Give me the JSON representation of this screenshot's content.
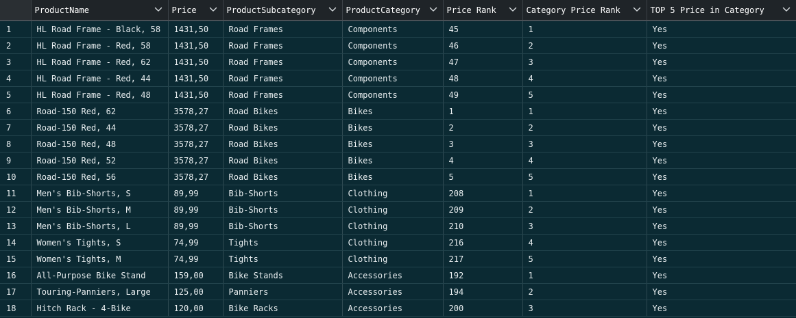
{
  "grid": {
    "columns": [
      {
        "key": "row",
        "label": ""
      },
      {
        "key": "ProductName",
        "label": "ProductName"
      },
      {
        "key": "Price",
        "label": "Price"
      },
      {
        "key": "ProductSubcategory",
        "label": "ProductSubcategory"
      },
      {
        "key": "ProductCategory",
        "label": "ProductCategory"
      },
      {
        "key": "PriceRank",
        "label": "Price Rank"
      },
      {
        "key": "CategoryPriceRank",
        "label": "Category Price Rank"
      },
      {
        "key": "Top5",
        "label": "TOP 5 Price in Category"
      }
    ],
    "rows": [
      [
        "1",
        "HL Road Frame - Black, 58",
        "1431,50",
        "Road Frames",
        "Components",
        "45",
        "1",
        "Yes"
      ],
      [
        "2",
        "HL Road Frame - Red, 58",
        "1431,50",
        "Road Frames",
        "Components",
        "46",
        "2",
        "Yes"
      ],
      [
        "3",
        "HL Road Frame - Red, 62",
        "1431,50",
        "Road Frames",
        "Components",
        "47",
        "3",
        "Yes"
      ],
      [
        "4",
        "HL Road Frame - Red, 44",
        "1431,50",
        "Road Frames",
        "Components",
        "48",
        "4",
        "Yes"
      ],
      [
        "5",
        "HL Road Frame - Red, 48",
        "1431,50",
        "Road Frames",
        "Components",
        "49",
        "5",
        "Yes"
      ],
      [
        "6",
        "Road-150 Red, 62",
        "3578,27",
        "Road Bikes",
        "Bikes",
        "1",
        "1",
        "Yes"
      ],
      [
        "7",
        "Road-150 Red, 44",
        "3578,27",
        "Road Bikes",
        "Bikes",
        "2",
        "2",
        "Yes"
      ],
      [
        "8",
        "Road-150 Red, 48",
        "3578,27",
        "Road Bikes",
        "Bikes",
        "3",
        "3",
        "Yes"
      ],
      [
        "9",
        "Road-150 Red, 52",
        "3578,27",
        "Road Bikes",
        "Bikes",
        "4",
        "4",
        "Yes"
      ],
      [
        "10",
        "Road-150 Red, 56",
        "3578,27",
        "Road Bikes",
        "Bikes",
        "5",
        "5",
        "Yes"
      ],
      [
        "11",
        "Men's Bib-Shorts, S",
        "89,99",
        "Bib-Shorts",
        "Clothing",
        "208",
        "1",
        "Yes"
      ],
      [
        "12",
        "Men's Bib-Shorts, M",
        "89,99",
        "Bib-Shorts",
        "Clothing",
        "209",
        "2",
        "Yes"
      ],
      [
        "13",
        "Men's Bib-Shorts, L",
        "89,99",
        "Bib-Shorts",
        "Clothing",
        "210",
        "3",
        "Yes"
      ],
      [
        "14",
        "Women's Tights, S",
        "74,99",
        "Tights",
        "Clothing",
        "216",
        "4",
        "Yes"
      ],
      [
        "15",
        "Women's Tights, M",
        "74,99",
        "Tights",
        "Clothing",
        "217",
        "5",
        "Yes"
      ],
      [
        "16",
        "All-Purpose Bike Stand",
        "159,00",
        "Bike Stands",
        "Accessories",
        "192",
        "1",
        "Yes"
      ],
      [
        "17",
        "Touring-Panniers, Large",
        "125,00",
        "Panniers",
        "Accessories",
        "194",
        "2",
        "Yes"
      ],
      [
        "18",
        "Hitch Rack - 4-Bike",
        "120,00",
        "Bike Racks",
        "Accessories",
        "200",
        "3",
        "Yes"
      ]
    ],
    "header_icon": "chevron-down-icon",
    "colors": {
      "background": "#0b2a33",
      "header_background": "#1f2428",
      "text": "#e9eef0"
    }
  }
}
